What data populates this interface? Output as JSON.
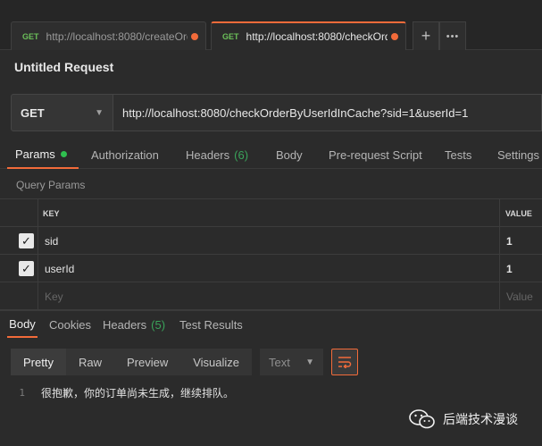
{
  "tabs": [
    {
      "method": "GET",
      "url": "http://localhost:8080/createOrd...",
      "active": false
    },
    {
      "method": "GET",
      "url": "http://localhost:8080/checkOrd...",
      "active": true
    }
  ],
  "tab_actions": {
    "add_label": "+",
    "more_label": "•••"
  },
  "request_title": "Untitled Request",
  "request": {
    "method": "GET",
    "url": "http://localhost:8080/checkOrderByUserIdInCache?sid=1&userId=1"
  },
  "request_tabs": {
    "params": "Params",
    "authorization": "Authorization",
    "headers": "Headers",
    "headers_count": "(6)",
    "body": "Body",
    "prerequest": "Pre-request Script",
    "tests": "Tests",
    "settings": "Settings"
  },
  "query_params_label": "Query Params",
  "params_table": {
    "headers": {
      "key": "KEY",
      "value": "VALUE"
    },
    "rows": [
      {
        "key": "sid",
        "value": "1",
        "checked": true
      },
      {
        "key": "userId",
        "value": "1",
        "checked": true
      }
    ],
    "placeholder": {
      "key": "Key",
      "value": "Value"
    }
  },
  "response_tabs": {
    "body": "Body",
    "cookies": "Cookies",
    "headers": "Headers",
    "headers_count": "(5)",
    "test_results": "Test Results"
  },
  "view_modes": [
    "Pretty",
    "Raw",
    "Preview",
    "Visualize"
  ],
  "format": "Text",
  "response_body": {
    "line_number": "1",
    "text": "很抱歉，你的订单尚未生成，继续排队。"
  },
  "watermark": "后端技术漫谈",
  "colors": {
    "accent": "#f26b3a",
    "method_green": "#6bbf59",
    "count_green": "#3aa35a"
  }
}
